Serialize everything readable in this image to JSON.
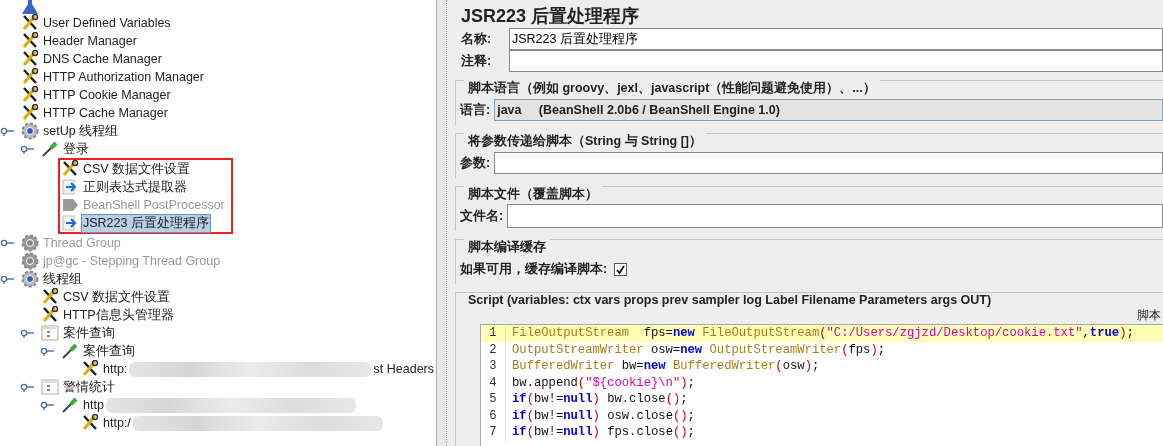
{
  "tree": {
    "kind": "flask",
    "expanded": true,
    "children": [
      {
        "kind": "tools",
        "label": "User Defined Variables",
        "selected": false,
        "disabled": false
      },
      {
        "kind": "tools",
        "label": "Header Manager",
        "selected": false,
        "disabled": false
      },
      {
        "kind": "tools",
        "label": "DNS Cache Manager",
        "selected": false,
        "disabled": false
      },
      {
        "kind": "tools",
        "label": "HTTP Authorization Manager",
        "selected": false,
        "disabled": false
      },
      {
        "kind": "tools",
        "label": "HTTP Cookie Manager",
        "selected": false,
        "disabled": false
      },
      {
        "kind": "tools",
        "label": "HTTP Cache Manager",
        "selected": false,
        "disabled": false
      },
      {
        "kind": "gear",
        "label": "setUp 线程组",
        "selected": false,
        "disabled": false,
        "expanded": true,
        "children": [
          {
            "kind": "dropper",
            "label": "登录",
            "selected": false,
            "disabled": false,
            "expanded": true,
            "highlight_box": true,
            "children": [
              {
                "kind": "tools",
                "label": "CSV 数据文件设置",
                "selected": false,
                "disabled": false
              },
              {
                "kind": "arrow",
                "label": "正则表达式提取器",
                "selected": false,
                "disabled": false
              },
              {
                "kind": "arrow",
                "label": "BeanShell PostProcessor",
                "selected": false,
                "disabled": true
              },
              {
                "kind": "arrow",
                "label": "JSR223 后置处理程序",
                "selected": true,
                "disabled": false
              }
            ]
          }
        ]
      },
      {
        "kind": "gear",
        "label": "Thread Group",
        "selected": false,
        "disabled": true,
        "expanded": false
      },
      {
        "kind": "gear",
        "label": "jp@gc - Stepping Thread Group",
        "selected": false,
        "disabled": true
      },
      {
        "kind": "gear",
        "label": "线程组",
        "selected": false,
        "disabled": false,
        "expanded": true,
        "children": [
          {
            "kind": "tools",
            "label": "CSV 数据文件设置",
            "selected": false,
            "disabled": false
          },
          {
            "kind": "tools",
            "label": "HTTP信息头管理器",
            "selected": false,
            "disabled": false
          },
          {
            "kind": "controller",
            "label": "案件查询",
            "selected": false,
            "disabled": false,
            "expanded": true,
            "children": [
              {
                "kind": "dropper",
                "label": "案件查询",
                "selected": false,
                "disabled": false,
                "expanded": true,
                "children": [
                  {
                    "kind": "tools",
                    "label": "http:",
                    "redacted": true,
                    "label_tail": "st Headers",
                    "selected": false,
                    "disabled": false
                  }
                ]
              }
            ]
          },
          {
            "kind": "controller",
            "label": "警情统计",
            "selected": false,
            "disabled": false,
            "expanded": true,
            "children": [
              {
                "kind": "dropper",
                "label": "http",
                "redacted": true,
                "selected": false,
                "disabled": false,
                "expanded": true,
                "children": [
                  {
                    "kind": "tools",
                    "label": "http:/",
                    "redacted": true,
                    "selected": false,
                    "disabled": false
                  }
                ]
              }
            ]
          }
        ]
      }
    ]
  },
  "editor": {
    "title": "JSR223 后置处理程序",
    "name_label": "名称:",
    "name_value": "JSR223 后置处理程序",
    "comment_label": "注释:",
    "language_group": "脚本语言（例如 groovy、jexl、javascript（性能问题避免使用）、...）",
    "language_label": "语言:",
    "language_value": "java     (BeanShell 2.0b6 / BeanShell Engine 1.0)",
    "params_group": "将参数传递给脚本（String 与 String []）",
    "params_label": "参数:",
    "file_group": "脚本文件（覆盖脚本）",
    "file_label": "文件名:",
    "cache_group": "脚本编译缓存",
    "cache_label": "如果可用，缓存编译脚本:",
    "cache_checked": true,
    "script_group": "Script (variables: ctx vars props prev sampler log Label Filename Parameters args OUT)",
    "script_side_label": "脚本",
    "code": [
      {
        "number": "1",
        "current": true,
        "tokens": [
          {
            "kind": "type",
            "text": "FileOutputStream"
          },
          {
            "kind": "plain",
            "text": "  fps="
          },
          {
            "kind": "keyword",
            "text": "new"
          },
          {
            "kind": "type",
            "text": " FileOutputStream"
          },
          {
            "kind": "paren",
            "text": "("
          },
          {
            "kind": "string",
            "text": "\"C:/Users/zgjzd/Desktop/cookie.txt\""
          },
          {
            "kind": "plain",
            "text": ","
          },
          {
            "kind": "keyword",
            "text": "true"
          },
          {
            "kind": "paren",
            "text": ")"
          },
          {
            "kind": "plain",
            "text": ";"
          }
        ]
      },
      {
        "number": "2",
        "current": false,
        "tokens": [
          {
            "kind": "type",
            "text": "OutputStreamWriter"
          },
          {
            "kind": "plain",
            "text": " osw="
          },
          {
            "kind": "keyword",
            "text": "new"
          },
          {
            "kind": "type",
            "text": " OutputStreamWriter"
          },
          {
            "kind": "paren",
            "text": "("
          },
          {
            "kind": "plain",
            "text": "fps"
          },
          {
            "kind": "paren",
            "text": ")"
          },
          {
            "kind": "plain",
            "text": ";"
          }
        ]
      },
      {
        "number": "3",
        "current": false,
        "tokens": [
          {
            "kind": "type",
            "text": "BufferedWriter"
          },
          {
            "kind": "plain",
            "text": " bw="
          },
          {
            "kind": "keyword",
            "text": "new"
          },
          {
            "kind": "type",
            "text": " BufferedWriter"
          },
          {
            "kind": "paren",
            "text": "("
          },
          {
            "kind": "plain",
            "text": "osw"
          },
          {
            "kind": "paren",
            "text": ")"
          },
          {
            "kind": "plain",
            "text": ";"
          }
        ]
      },
      {
        "number": "4",
        "current": false,
        "tokens": [
          {
            "kind": "plain",
            "text": "bw.append"
          },
          {
            "kind": "paren",
            "text": "("
          },
          {
            "kind": "string",
            "text": "\"${cookie}\\n\""
          },
          {
            "kind": "paren",
            "text": ")"
          },
          {
            "kind": "plain",
            "text": ";"
          }
        ]
      },
      {
        "number": "5",
        "current": false,
        "tokens": [
          {
            "kind": "keyword",
            "text": "if"
          },
          {
            "kind": "paren",
            "text": "("
          },
          {
            "kind": "plain",
            "text": "bw!="
          },
          {
            "kind": "keyword",
            "text": "null"
          },
          {
            "kind": "paren",
            "text": ")"
          },
          {
            "kind": "plain",
            "text": " bw.close"
          },
          {
            "kind": "paren",
            "text": "()"
          },
          {
            "kind": "plain",
            "text": ";"
          }
        ]
      },
      {
        "number": "6",
        "current": false,
        "tokens": [
          {
            "kind": "keyword",
            "text": "if"
          },
          {
            "kind": "paren",
            "text": "("
          },
          {
            "kind": "plain",
            "text": "bw!="
          },
          {
            "kind": "keyword",
            "text": "null"
          },
          {
            "kind": "paren",
            "text": ")"
          },
          {
            "kind": "plain",
            "text": " osw.close"
          },
          {
            "kind": "paren",
            "text": "()"
          },
          {
            "kind": "plain",
            "text": ";"
          }
        ]
      },
      {
        "number": "7",
        "current": false,
        "tokens": [
          {
            "kind": "keyword",
            "text": "if"
          },
          {
            "kind": "paren",
            "text": "("
          },
          {
            "kind": "plain",
            "text": "bw!="
          },
          {
            "kind": "keyword",
            "text": "null"
          },
          {
            "kind": "paren",
            "text": ")"
          },
          {
            "kind": "plain",
            "text": " fps.close"
          },
          {
            "kind": "paren",
            "text": "()"
          },
          {
            "kind": "plain",
            "text": ";"
          }
        ]
      }
    ]
  }
}
